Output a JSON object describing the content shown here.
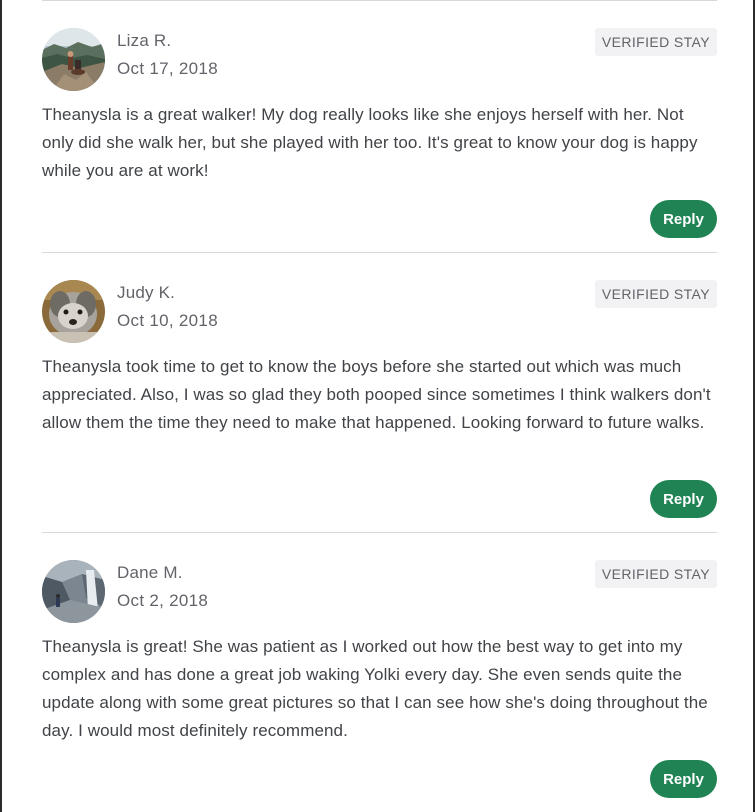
{
  "reviews": [
    {
      "name": "Liza R.",
      "date": "Oct 17, 2018",
      "badge": "VERIFIED STAY",
      "text": "Theanysla is a great walker! My dog really looks like she enjoys herself with her. Not only did she walk her, but she played with her too. It's great to know your dog is happy while you are at work!",
      "reply_label": "Reply"
    },
    {
      "name": "Judy K.",
      "date": "Oct 10, 2018",
      "badge": "VERIFIED STAY",
      "text": "Theanysla took time to get to know the boys before she started out which was much appreciated. Also, I was so glad they both pooped since sometimes I think walkers don't allow them the time they need to make that happened. Looking forward to future walks.",
      "reply_label": "Reply"
    },
    {
      "name": "Dane M.",
      "date": "Oct 2, 2018",
      "badge": "VERIFIED STAY",
      "text": "Theanysla is great! She was patient as I worked out how the best way to get into my complex and has done a great job waking Yolki every day. She even sends quite the update along with some great pictures so that I can see how she's doing throughout the day. I would most definitely recommend.",
      "reply_label": "Reply"
    }
  ],
  "colors": {
    "reply_button": "#1f8354",
    "badge_bg": "#f2f2f4",
    "meta_text": "#62646a",
    "body_text": "#404347",
    "divider": "#d8d8d8"
  }
}
